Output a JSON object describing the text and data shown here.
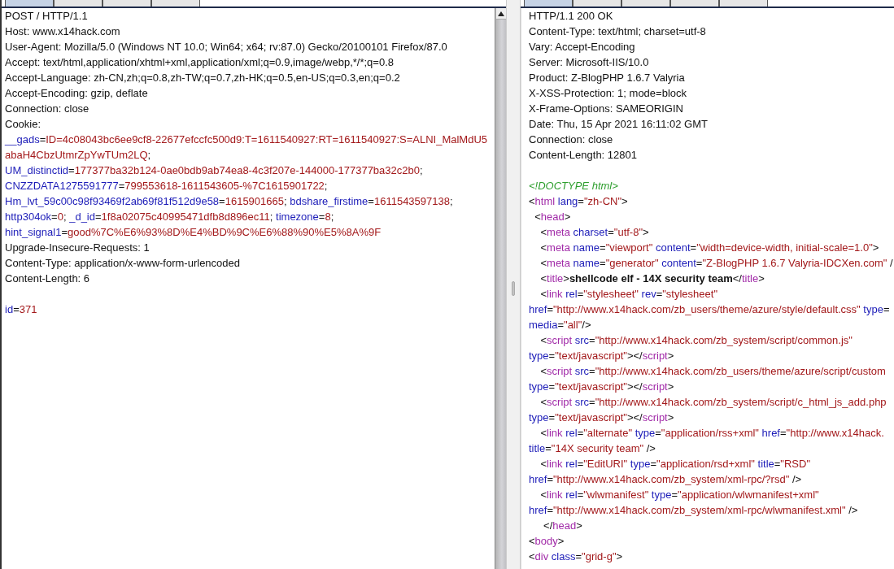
{
  "request": {
    "tabs": [
      {
        "selected": true
      },
      {
        "selected": false
      },
      {
        "selected": false
      },
      {
        "selected": false
      }
    ],
    "lines": [
      {
        "kind": "code",
        "parts": [
          {
            "kind": "text",
            "text": "POST / HTTP/1.1"
          }
        ]
      },
      {
        "kind": "code",
        "parts": [
          {
            "kind": "text",
            "text": "Host: www.x14hack.com"
          }
        ]
      },
      {
        "kind": "code",
        "parts": [
          {
            "kind": "text",
            "text": "User-Agent: Mozilla/5.0 (Windows NT 10.0; Win64; x64; rv:87.0) Gecko/20100101 Firefox/87.0"
          }
        ]
      },
      {
        "kind": "code",
        "parts": [
          {
            "kind": "text",
            "text": "Accept: text/html,application/xhtml+xml,application/xml;q=0.9,image/webp,*/*;q=0.8"
          }
        ]
      },
      {
        "kind": "code",
        "parts": [
          {
            "kind": "text",
            "text": "Accept-Language: zh-CN,zh;q=0.8,zh-TW;q=0.7,zh-HK;q=0.5,en-US;q=0.3,en;q=0.2"
          }
        ]
      },
      {
        "kind": "code",
        "parts": [
          {
            "kind": "text",
            "text": "Accept-Encoding: gzip, deflate"
          }
        ]
      },
      {
        "kind": "code",
        "parts": [
          {
            "kind": "text",
            "text": "Connection: close"
          }
        ]
      },
      {
        "kind": "code",
        "parts": [
          {
            "kind": "text",
            "text": "Cookie:"
          }
        ]
      },
      {
        "kind": "code",
        "parts": [
          {
            "kind": "name",
            "text": "__gads"
          },
          {
            "kind": "text",
            "text": "="
          },
          {
            "kind": "value",
            "text": "ID=4c08043bc6ee9cf8-22677efccfc500d9:T=1611540927:RT=1611540927:S=ALNI_MalMdU5"
          }
        ]
      },
      {
        "kind": "code",
        "parts": [
          {
            "kind": "value",
            "text": "abaH4CbzUtmrZpYwTUm2LQ"
          },
          {
            "kind": "text",
            "text": ";"
          }
        ]
      },
      {
        "kind": "code",
        "parts": [
          {
            "kind": "name",
            "text": "UM_distinctid"
          },
          {
            "kind": "text",
            "text": "="
          },
          {
            "kind": "value",
            "text": "177377ba32b124-0ae0bdb9ab74ea8-4c3f207e-144000-177377ba32c2b0"
          },
          {
            "kind": "text",
            "text": ";"
          }
        ]
      },
      {
        "kind": "code",
        "parts": [
          {
            "kind": "name",
            "text": "CNZZDATA1275591777"
          },
          {
            "kind": "text",
            "text": "="
          },
          {
            "kind": "value",
            "text": "799553618-1611543605-%7C1615901722"
          },
          {
            "kind": "text",
            "text": ";"
          }
        ]
      },
      {
        "kind": "code",
        "parts": [
          {
            "kind": "name",
            "text": "Hm_lvt_59c00c98f93469f2ab69f81f512d9e58"
          },
          {
            "kind": "text",
            "text": "="
          },
          {
            "kind": "value",
            "text": "1615901665"
          },
          {
            "kind": "text",
            "text": ";"
          },
          {
            "kind": "name",
            "text": " bdshare_firstime"
          },
          {
            "kind": "text",
            "text": "="
          },
          {
            "kind": "value",
            "text": "1611543597138"
          },
          {
            "kind": "text",
            "text": ";"
          }
        ]
      },
      {
        "kind": "code",
        "parts": [
          {
            "kind": "name",
            "text": "http304ok"
          },
          {
            "kind": "text",
            "text": "="
          },
          {
            "kind": "value",
            "text": "0"
          },
          {
            "kind": "text",
            "text": ";"
          },
          {
            "kind": "name",
            "text": " _d_id"
          },
          {
            "kind": "text",
            "text": "="
          },
          {
            "kind": "value",
            "text": "1f8a02075c40995471dfb8d896ec11"
          },
          {
            "kind": "text",
            "text": ";"
          },
          {
            "kind": "name",
            "text": " timezone"
          },
          {
            "kind": "text",
            "text": "="
          },
          {
            "kind": "value",
            "text": "8"
          },
          {
            "kind": "text",
            "text": ";"
          }
        ]
      },
      {
        "kind": "code",
        "parts": [
          {
            "kind": "name",
            "text": "hint_signal1"
          },
          {
            "kind": "text",
            "text": "="
          },
          {
            "kind": "value",
            "text": "good%7C%E6%93%8D%E4%BD%9C%E6%88%90%E5%8A%9F"
          }
        ]
      },
      {
        "kind": "code",
        "parts": [
          {
            "kind": "text",
            "text": "Upgrade-Insecure-Requests: 1"
          }
        ]
      },
      {
        "kind": "code",
        "parts": [
          {
            "kind": "text",
            "text": "Content-Type: application/x-www-form-urlencoded"
          }
        ]
      },
      {
        "kind": "code",
        "parts": [
          {
            "kind": "text",
            "text": "Content-Length: 6"
          }
        ]
      },
      {
        "kind": "blank"
      },
      {
        "kind": "code",
        "parts": [
          {
            "kind": "name",
            "text": "id"
          },
          {
            "kind": "text",
            "text": "="
          },
          {
            "kind": "value",
            "text": "371"
          }
        ]
      }
    ]
  },
  "response": {
    "tabs": [
      {
        "selected": true
      },
      {
        "selected": false
      },
      {
        "selected": false
      },
      {
        "selected": false
      },
      {
        "selected": false
      }
    ],
    "lines": [
      {
        "kind": "code",
        "parts": [
          {
            "kind": "text",
            "text": "HTTP/1.1 200 OK"
          }
        ]
      },
      {
        "kind": "code",
        "parts": [
          {
            "kind": "text",
            "text": "Content-Type: text/html; charset=utf-8"
          }
        ]
      },
      {
        "kind": "code",
        "parts": [
          {
            "kind": "text",
            "text": "Vary: Accept-Encoding"
          }
        ]
      },
      {
        "kind": "code",
        "parts": [
          {
            "kind": "text",
            "text": "Server: Microsoft-IIS/10.0"
          }
        ]
      },
      {
        "kind": "code",
        "parts": [
          {
            "kind": "text",
            "text": "Product: Z-BlogPHP 1.6.7 Valyria"
          }
        ]
      },
      {
        "kind": "code",
        "parts": [
          {
            "kind": "text",
            "text": "X-XSS-Protection: 1; mode=block"
          }
        ]
      },
      {
        "kind": "code",
        "parts": [
          {
            "kind": "text",
            "text": "X-Frame-Options: SAMEORIGIN"
          }
        ]
      },
      {
        "kind": "code",
        "parts": [
          {
            "kind": "text",
            "text": "Date: Thu, 15 Apr 2021 16:11:02 GMT"
          }
        ]
      },
      {
        "kind": "code",
        "parts": [
          {
            "kind": "text",
            "text": "Connection: close"
          }
        ]
      },
      {
        "kind": "code",
        "parts": [
          {
            "kind": "text",
            "text": "Content-Length: 12801"
          }
        ]
      },
      {
        "kind": "blank"
      },
      {
        "kind": "code",
        "parts": [
          {
            "kind": "comment",
            "text": "<!DOCTYPE html>"
          }
        ]
      },
      {
        "kind": "code",
        "parts": [
          {
            "kind": "text",
            "text": "<"
          },
          {
            "kind": "tag",
            "text": "html"
          },
          {
            "kind": "name",
            "text": " lang"
          },
          {
            "kind": "text",
            "text": "="
          },
          {
            "kind": "value",
            "text": "\"zh-CN\""
          },
          {
            "kind": "text",
            "text": ">"
          }
        ]
      },
      {
        "kind": "code",
        "parts": [
          {
            "kind": "text",
            "text": "  <"
          },
          {
            "kind": "tag",
            "text": "head"
          },
          {
            "kind": "text",
            "text": ">"
          }
        ]
      },
      {
        "kind": "code",
        "parts": [
          {
            "kind": "text",
            "text": "    <"
          },
          {
            "kind": "tag",
            "text": "meta"
          },
          {
            "kind": "name",
            "text": " charset"
          },
          {
            "kind": "text",
            "text": "="
          },
          {
            "kind": "value",
            "text": "\"utf-8\""
          },
          {
            "kind": "text",
            "text": ">"
          }
        ]
      },
      {
        "kind": "code",
        "parts": [
          {
            "kind": "text",
            "text": "    <"
          },
          {
            "kind": "tag",
            "text": "meta"
          },
          {
            "kind": "name",
            "text": " name"
          },
          {
            "kind": "text",
            "text": "="
          },
          {
            "kind": "value",
            "text": "\"viewport\""
          },
          {
            "kind": "name",
            "text": " content"
          },
          {
            "kind": "text",
            "text": "="
          },
          {
            "kind": "value",
            "text": "\"width=device-width, initial-scale=1.0\""
          },
          {
            "kind": "text",
            "text": ">"
          }
        ]
      },
      {
        "kind": "code",
        "parts": [
          {
            "kind": "text",
            "text": "    <"
          },
          {
            "kind": "tag",
            "text": "meta"
          },
          {
            "kind": "name",
            "text": " name"
          },
          {
            "kind": "text",
            "text": "="
          },
          {
            "kind": "value",
            "text": "\"generator\""
          },
          {
            "kind": "name",
            "text": " content"
          },
          {
            "kind": "text",
            "text": "="
          },
          {
            "kind": "value",
            "text": "\"Z-BlogPHP 1.6.7 Valyria-IDCXen.com\""
          },
          {
            "kind": "text",
            "text": " /"
          }
        ]
      },
      {
        "kind": "code",
        "parts": [
          {
            "kind": "text",
            "text": "    <"
          },
          {
            "kind": "tag",
            "text": "title"
          },
          {
            "kind": "text",
            "text": ">"
          },
          {
            "kind": "bold",
            "text": "shellcode elf - 14X security team"
          },
          {
            "kind": "text",
            "text": "</"
          },
          {
            "kind": "tag",
            "text": "title"
          },
          {
            "kind": "text",
            "text": ">"
          }
        ]
      },
      {
        "kind": "code",
        "parts": [
          {
            "kind": "text",
            "text": "    <"
          },
          {
            "kind": "tag",
            "text": "link"
          },
          {
            "kind": "name",
            "text": " rel"
          },
          {
            "kind": "text",
            "text": "="
          },
          {
            "kind": "value",
            "text": "\"stylesheet\""
          },
          {
            "kind": "name",
            "text": " rev"
          },
          {
            "kind": "text",
            "text": "="
          },
          {
            "kind": "value",
            "text": "\"stylesheet\""
          }
        ]
      },
      {
        "kind": "code",
        "parts": [
          {
            "kind": "name",
            "text": "href"
          },
          {
            "kind": "text",
            "text": "="
          },
          {
            "kind": "value",
            "text": "\"http://www.x14hack.com/zb_users/theme/azure/style/default.css\""
          },
          {
            "kind": "name",
            "text": " type"
          },
          {
            "kind": "text",
            "text": "="
          }
        ]
      },
      {
        "kind": "code",
        "parts": [
          {
            "kind": "name",
            "text": "media"
          },
          {
            "kind": "text",
            "text": "="
          },
          {
            "kind": "value",
            "text": "\"all\""
          },
          {
            "kind": "text",
            "text": "/>"
          }
        ]
      },
      {
        "kind": "code",
        "parts": [
          {
            "kind": "text",
            "text": "    <"
          },
          {
            "kind": "tag",
            "text": "script"
          },
          {
            "kind": "name",
            "text": " src"
          },
          {
            "kind": "text",
            "text": "="
          },
          {
            "kind": "value",
            "text": "\"http://www.x14hack.com/zb_system/script/common.js\""
          }
        ]
      },
      {
        "kind": "code",
        "parts": [
          {
            "kind": "name",
            "text": "type"
          },
          {
            "kind": "text",
            "text": "="
          },
          {
            "kind": "value",
            "text": "\"text/javascript\""
          },
          {
            "kind": "text",
            "text": "></"
          },
          {
            "kind": "tag",
            "text": "script"
          },
          {
            "kind": "text",
            "text": ">"
          }
        ]
      },
      {
        "kind": "code",
        "parts": [
          {
            "kind": "text",
            "text": "    <"
          },
          {
            "kind": "tag",
            "text": "script"
          },
          {
            "kind": "name",
            "text": " src"
          },
          {
            "kind": "text",
            "text": "="
          },
          {
            "kind": "value",
            "text": "\"http://www.x14hack.com/zb_users/theme/azure/script/custom"
          }
        ]
      },
      {
        "kind": "code",
        "parts": [
          {
            "kind": "name",
            "text": "type"
          },
          {
            "kind": "text",
            "text": "="
          },
          {
            "kind": "value",
            "text": "\"text/javascript\""
          },
          {
            "kind": "text",
            "text": "></"
          },
          {
            "kind": "tag",
            "text": "script"
          },
          {
            "kind": "text",
            "text": ">"
          }
        ]
      },
      {
        "kind": "code",
        "parts": [
          {
            "kind": "text",
            "text": "    <"
          },
          {
            "kind": "tag",
            "text": "script"
          },
          {
            "kind": "name",
            "text": " src"
          },
          {
            "kind": "text",
            "text": "="
          },
          {
            "kind": "value",
            "text": "\"http://www.x14hack.com/zb_system/script/c_html_js_add.php"
          }
        ]
      },
      {
        "kind": "code",
        "parts": [
          {
            "kind": "name",
            "text": "type"
          },
          {
            "kind": "text",
            "text": "="
          },
          {
            "kind": "value",
            "text": "\"text/javascript\""
          },
          {
            "kind": "text",
            "text": "></"
          },
          {
            "kind": "tag",
            "text": "script"
          },
          {
            "kind": "text",
            "text": ">"
          }
        ]
      },
      {
        "kind": "code",
        "parts": [
          {
            "kind": "text",
            "text": "    <"
          },
          {
            "kind": "tag",
            "text": "link"
          },
          {
            "kind": "name",
            "text": " rel"
          },
          {
            "kind": "text",
            "text": "="
          },
          {
            "kind": "value",
            "text": "\"alternate\""
          },
          {
            "kind": "name",
            "text": " type"
          },
          {
            "kind": "text",
            "text": "="
          },
          {
            "kind": "value",
            "text": "\"application/rss+xml\""
          },
          {
            "kind": "name",
            "text": " href"
          },
          {
            "kind": "text",
            "text": "="
          },
          {
            "kind": "value",
            "text": "\"http://www.x14hack."
          }
        ]
      },
      {
        "kind": "code",
        "parts": [
          {
            "kind": "name",
            "text": "title"
          },
          {
            "kind": "text",
            "text": "="
          },
          {
            "kind": "value",
            "text": "\"14X security team\""
          },
          {
            "kind": "text",
            "text": " />"
          }
        ]
      },
      {
        "kind": "code",
        "parts": [
          {
            "kind": "text",
            "text": "    <"
          },
          {
            "kind": "tag",
            "text": "link"
          },
          {
            "kind": "name",
            "text": " rel"
          },
          {
            "kind": "text",
            "text": "="
          },
          {
            "kind": "value",
            "text": "\"EditURI\""
          },
          {
            "kind": "name",
            "text": " type"
          },
          {
            "kind": "text",
            "text": "="
          },
          {
            "kind": "value",
            "text": "\"application/rsd+xml\""
          },
          {
            "kind": "name",
            "text": " title"
          },
          {
            "kind": "text",
            "text": "="
          },
          {
            "kind": "value",
            "text": "\"RSD\""
          }
        ]
      },
      {
        "kind": "code",
        "parts": [
          {
            "kind": "name",
            "text": "href"
          },
          {
            "kind": "text",
            "text": "="
          },
          {
            "kind": "value",
            "text": "\"http://www.x14hack.com/zb_system/xml-rpc/?rsd\""
          },
          {
            "kind": "text",
            "text": " />"
          }
        ]
      },
      {
        "kind": "code",
        "parts": [
          {
            "kind": "text",
            "text": "    <"
          },
          {
            "kind": "tag",
            "text": "link"
          },
          {
            "kind": "name",
            "text": " rel"
          },
          {
            "kind": "text",
            "text": "="
          },
          {
            "kind": "value",
            "text": "\"wlwmanifest\""
          },
          {
            "kind": "name",
            "text": " type"
          },
          {
            "kind": "text",
            "text": "="
          },
          {
            "kind": "value",
            "text": "\"application/wlwmanifest+xml\""
          }
        ]
      },
      {
        "kind": "code",
        "parts": [
          {
            "kind": "name",
            "text": "href"
          },
          {
            "kind": "text",
            "text": "="
          },
          {
            "kind": "value",
            "text": "\"http://www.x14hack.com/zb_system/xml-rpc/wlwmanifest.xml\""
          },
          {
            "kind": "text",
            "text": " />"
          }
        ]
      },
      {
        "kind": "code",
        "parts": [
          {
            "kind": "text",
            "text": "     </"
          },
          {
            "kind": "tag",
            "text": "head"
          },
          {
            "kind": "text",
            "text": ">"
          }
        ]
      },
      {
        "kind": "code",
        "parts": [
          {
            "kind": "text",
            "text": "<"
          },
          {
            "kind": "tag",
            "text": "body"
          },
          {
            "kind": "text",
            "text": ">"
          }
        ]
      },
      {
        "kind": "code",
        "parts": [
          {
            "kind": "text",
            "text": "<"
          },
          {
            "kind": "tag",
            "text": "div"
          },
          {
            "kind": "name",
            "text": " class"
          },
          {
            "kind": "text",
            "text": "="
          },
          {
            "kind": "value",
            "text": "\"grid-g\""
          },
          {
            "kind": "text",
            "text": ">"
          }
        ]
      }
    ]
  }
}
